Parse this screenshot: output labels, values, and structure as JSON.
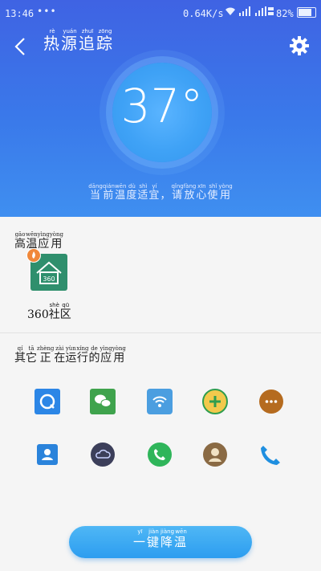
{
  "status_bar": {
    "time": "13:46",
    "dots": "•••",
    "net_speed": "0.64K/s",
    "battery": "82%"
  },
  "header": {
    "title_ruby": [
      {
        "ch": "热",
        "py": "rè"
      },
      {
        "ch": "源",
        "py": "yuán"
      },
      {
        "ch": "追",
        "py": "zhuī"
      },
      {
        "ch": "踪",
        "py": "zōng"
      }
    ],
    "temperature": "37°",
    "status_ruby": [
      {
        "ch": "当",
        "py": "dāng"
      },
      {
        "ch": "前",
        "py": "qián"
      },
      {
        "ch": "温",
        "py": "wēn"
      },
      {
        "ch": "度",
        "py": "dù"
      },
      {
        "ch": "适",
        "py": "shì"
      },
      {
        "ch": "宜",
        "py": "yí"
      },
      {
        "ch": "，",
        "py": ""
      },
      {
        "ch": "请",
        "py": "qǐng"
      },
      {
        "ch": "放",
        "py": "fàng"
      },
      {
        "ch": "心",
        "py": "xīn"
      },
      {
        "ch": "使",
        "py": "shǐ"
      },
      {
        "ch": "用",
        "py": "yòng"
      }
    ]
  },
  "hot_section": {
    "heading_ruby": [
      {
        "ch": "高",
        "py": "gāo"
      },
      {
        "ch": "温",
        "py": "wēn"
      },
      {
        "ch": "应",
        "py": "yìng"
      },
      {
        "ch": "用",
        "py": "yòng"
      }
    ],
    "app_icon_text": "360",
    "app_label_ruby": [
      {
        "ch": "360",
        "py": ""
      },
      {
        "ch": "社",
        "py": "shè"
      },
      {
        "ch": "区",
        "py": "qū"
      }
    ]
  },
  "running_section": {
    "heading_ruby": [
      {
        "ch": "其",
        "py": "qí"
      },
      {
        "ch": "它",
        "py": "tā"
      },
      {
        "ch": "正",
        "py": "zhèng"
      },
      {
        "ch": "在",
        "py": "zài"
      },
      {
        "ch": "运",
        "py": "yùn"
      },
      {
        "ch": "行",
        "py": "xíng"
      },
      {
        "ch": "的",
        "py": "de"
      },
      {
        "ch": "应",
        "py": "yìng"
      },
      {
        "ch": "用",
        "py": "yòng"
      }
    ],
    "apps": [
      {
        "icon": "qq-browser-icon",
        "color": "#2c86e6"
      },
      {
        "icon": "wechat-icon",
        "color": "#3fa34d"
      },
      {
        "icon": "wifi-icon",
        "color": "#4b9ee0"
      },
      {
        "icon": "plus-circle-icon",
        "color": "#2f9d4f"
      },
      {
        "icon": "chat-bubble-icon",
        "color": "#b56b1f"
      },
      {
        "icon": "contacts-icon",
        "color": "#2a83db"
      },
      {
        "icon": "cloud-icon",
        "color": "#3c3f5a"
      },
      {
        "icon": "phone-green-icon",
        "color": "#2fb55a"
      },
      {
        "icon": "avatar-icon",
        "color": "#8a6a44"
      },
      {
        "icon": "phone-blue-icon",
        "color": "#1f8fe0"
      }
    ]
  },
  "button_ruby": [
    {
      "ch": "一",
      "py": "yī"
    },
    {
      "ch": "键",
      "py": "jiàn"
    },
    {
      "ch": "降",
      "py": "jiàng"
    },
    {
      "ch": "温",
      "py": "wēn"
    }
  ],
  "colors": {
    "header_top": "#3f63e3",
    "header_bottom": "#3f8ff0",
    "button": "#2c9df0"
  }
}
